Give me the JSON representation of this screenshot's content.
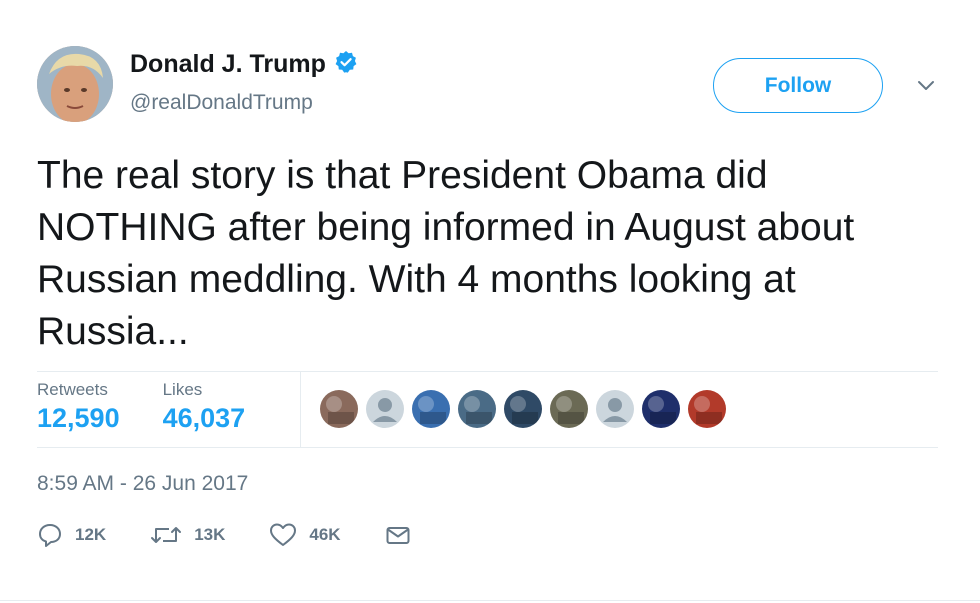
{
  "author": {
    "name": "Donald J. Trump",
    "handle": "@realDonaldTrump",
    "verified": true,
    "verified_color": "#1da1f2"
  },
  "follow_button": {
    "label": "Follow",
    "color": "#1da1f2"
  },
  "tweet": {
    "text": "The real story is that President Obama did NOTHING after being informed in August about Russian meddling. With 4 months looking at Russia...",
    "timestamp": "8:59 AM - 26 Jun 2017"
  },
  "stats": {
    "retweets_label": "Retweets",
    "retweets_value": "12,590",
    "likes_label": "Likes",
    "likes_value": "46,037"
  },
  "liker_avatars": [
    {
      "kind": "photo",
      "color": "#8a6a5c"
    },
    {
      "kind": "default",
      "color": "#ccd6dd"
    },
    {
      "kind": "photo",
      "color": "#3a6fb0"
    },
    {
      "kind": "photo",
      "color": "#4a6b86"
    },
    {
      "kind": "photo",
      "color": "#2f4a66"
    },
    {
      "kind": "photo",
      "color": "#6b6a55"
    },
    {
      "kind": "default",
      "color": "#ccd6dd"
    },
    {
      "kind": "photo",
      "color": "#1f2f6b"
    },
    {
      "kind": "photo",
      "color": "#b23a2a"
    }
  ],
  "actions": {
    "reply_icon": "reply-icon",
    "reply_count": "12K",
    "retweet_icon": "retweet-icon",
    "retweet_count": "13K",
    "like_icon": "heart-icon",
    "like_count": "46K",
    "message_icon": "envelope-icon"
  },
  "colors": {
    "secondary_text": "#657786",
    "primary_text": "#14171a",
    "accent": "#1da1f2"
  }
}
